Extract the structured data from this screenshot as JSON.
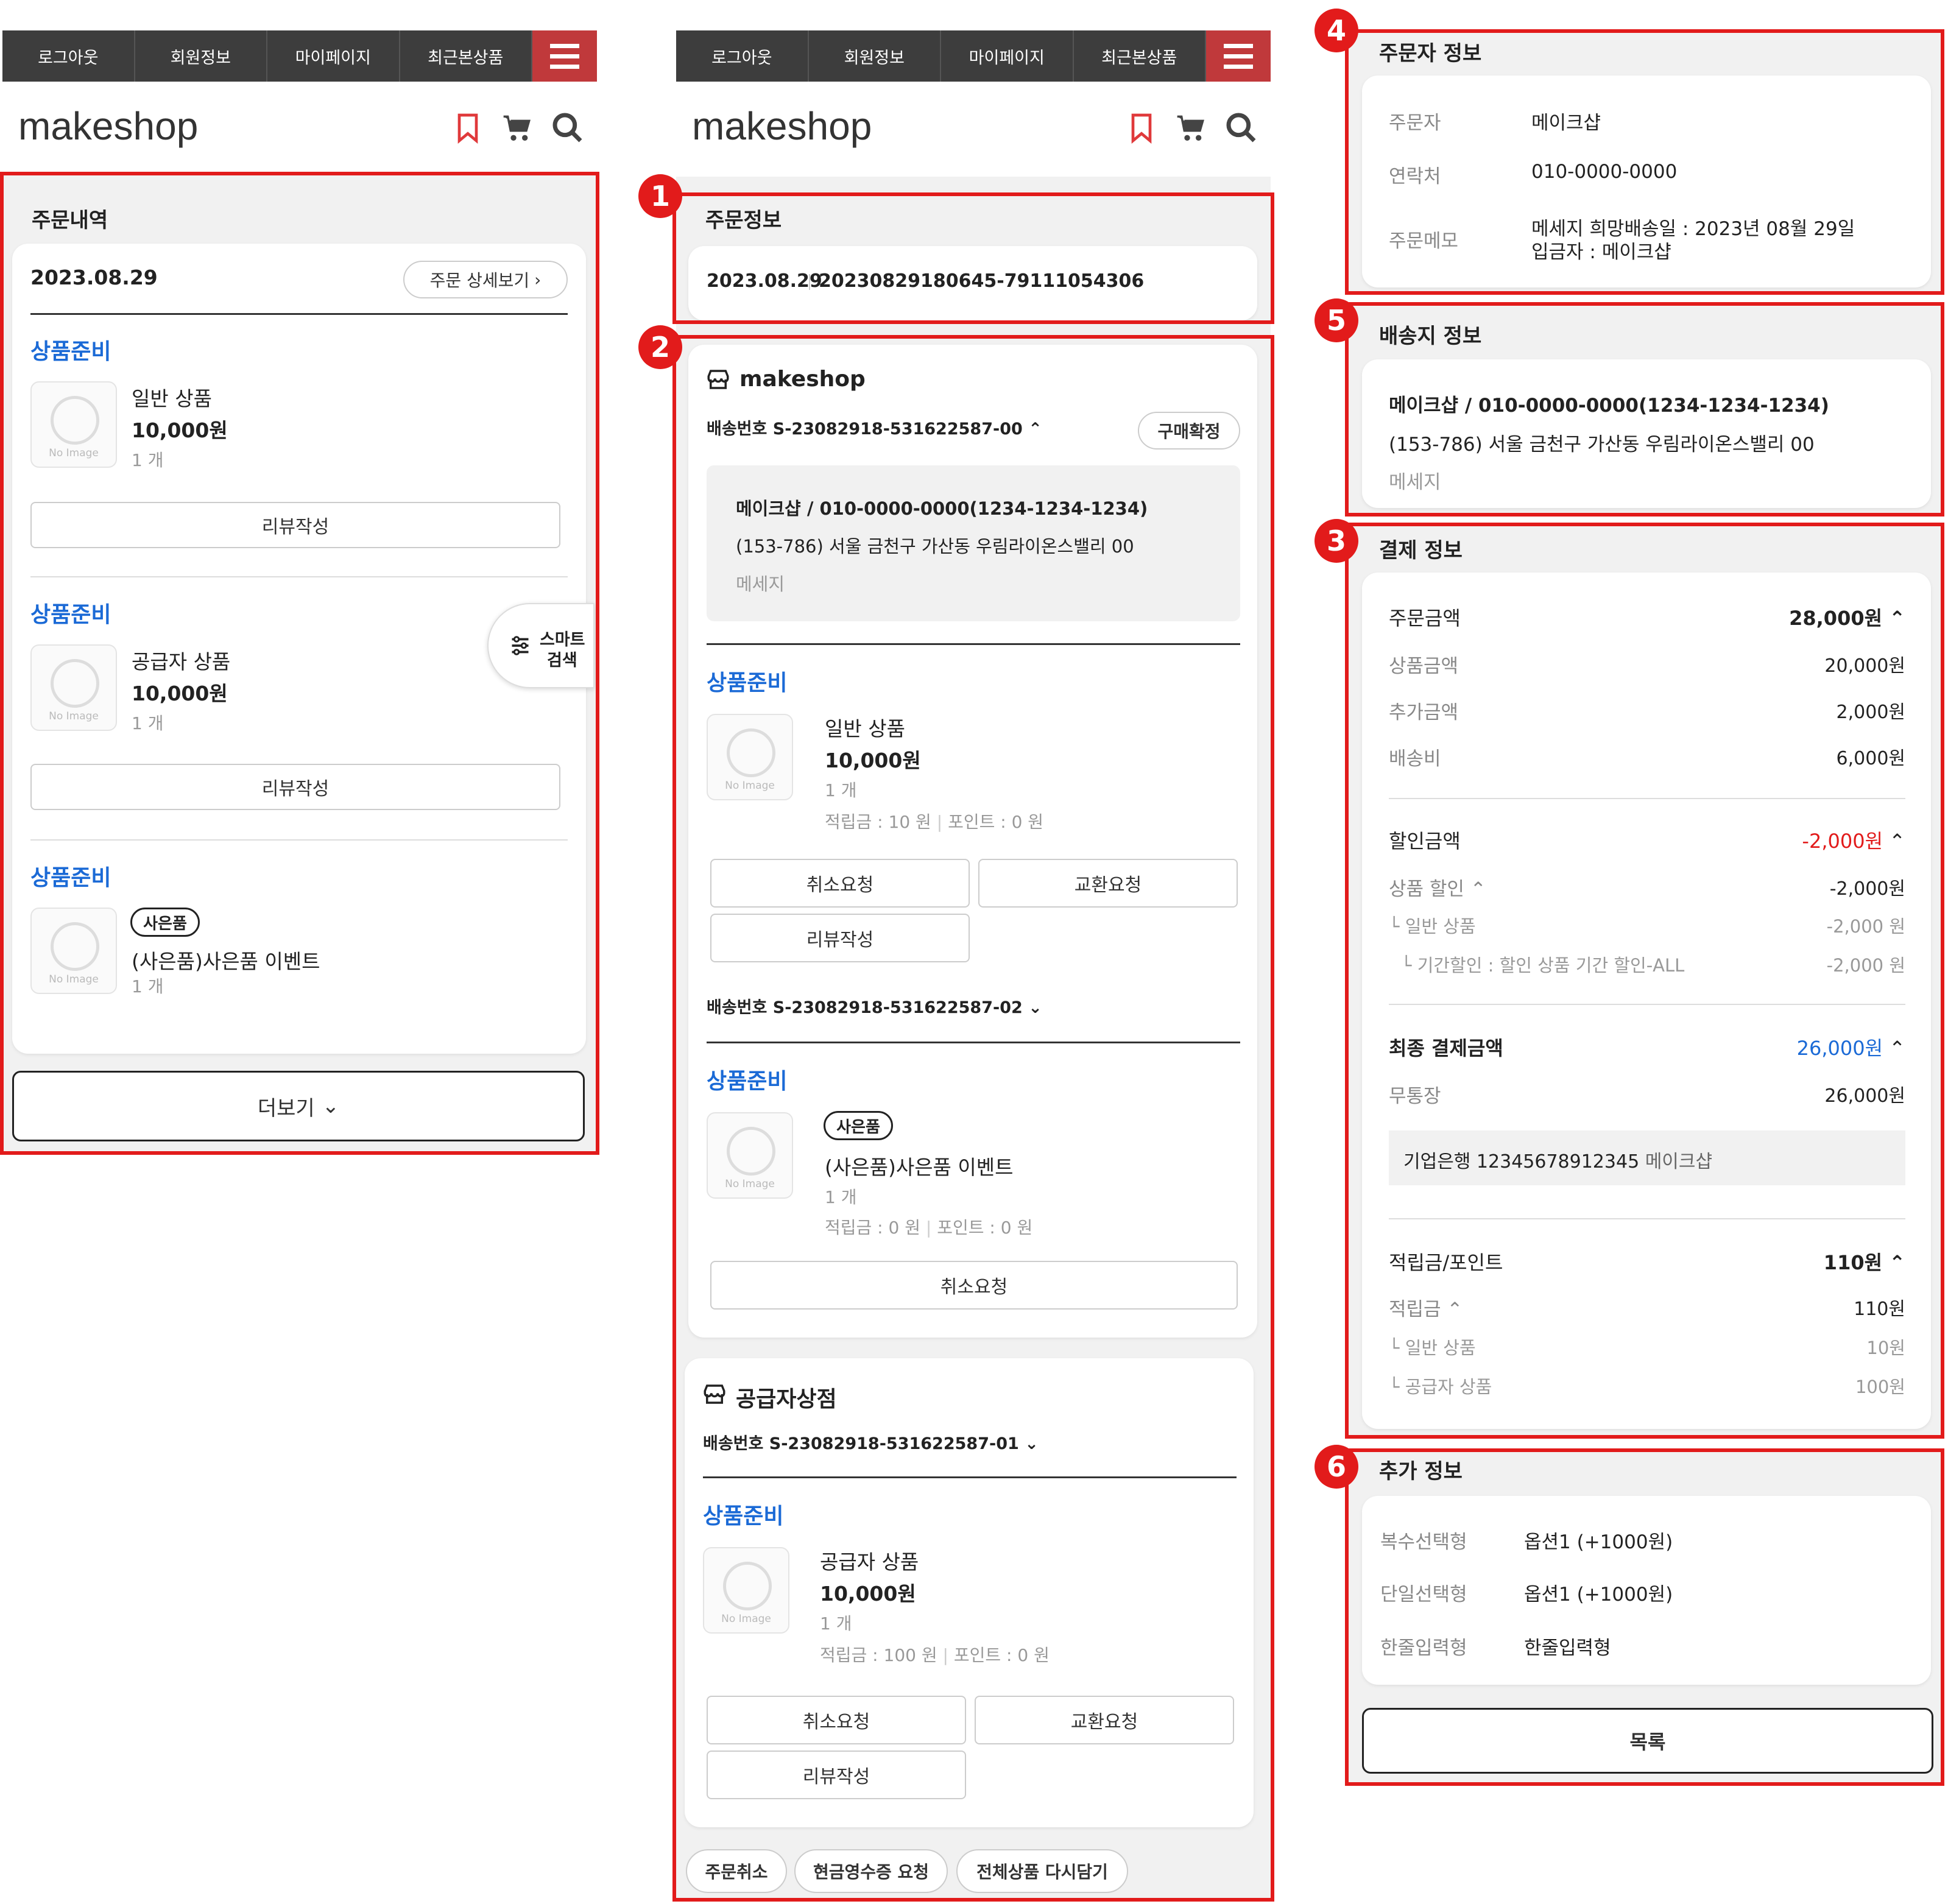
{
  "nav": {
    "items": [
      "로그아웃",
      "회원정보",
      "마이페이지",
      "최근본상품"
    ]
  },
  "header": {
    "logo": "makeshop"
  },
  "p1": {
    "section_title": "주문내역",
    "order_date": "2023.08.29",
    "detail_button": "주문 상세보기",
    "items": [
      {
        "status": "상품준비",
        "name": "일반 상품",
        "price": "10,000원",
        "qty": "1 개",
        "review": "리뷰작성"
      },
      {
        "status": "상품준비",
        "name": "공급자 상품",
        "price": "10,000원",
        "qty": "1 개",
        "review": "리뷰작성"
      },
      {
        "status": "상품준비",
        "tag": "사은품",
        "name": "(사은품)사은품 이벤트",
        "qty": "1 개"
      }
    ],
    "smart_search_line1": "스마트",
    "smart_search_line2": "검색",
    "more_button": "더보기",
    "noimage": "No Image"
  },
  "p2": {
    "badge1": "1",
    "badge2": "2",
    "order_info_title": "주문정보",
    "order_date": "2023.08.29",
    "order_no": "20230829180645-79111054306",
    "shop1": "makeshop",
    "ship1": "배송번호 S-23082918-531622587-00",
    "confirm": "구매확정",
    "addr_name": "메이크샵 / 010-0000-0000(1234-1234-1234)",
    "addr": "(153-786) 서울 금천구 가산동 우림라이온스밸리 00",
    "addr_msg": "메세지",
    "status": "상품준비",
    "item1": {
      "name": "일반 상품",
      "price": "10,000원",
      "qty": "1 개",
      "points": "적립금 : 10 원",
      "pts2": "포인트 : 0 원"
    },
    "cancel": "취소요청",
    "exchange": "교환요청",
    "review": "리뷰작성",
    "ship2": "배송번호 S-23082918-531622587-02",
    "item2": {
      "tag": "사은품",
      "name": "(사은품)사은품 이벤트",
      "qty": "1 개",
      "points": "적립금 : 0 원",
      "pts2": "포인트 : 0 원"
    },
    "shop2": "공급자상점",
    "ship3": "배송번호 S-23082918-531622587-01",
    "item3": {
      "name": "공급자 상품",
      "price": "10,000원",
      "qty": "1 개",
      "points": "적립금 : 100 원",
      "pts2": "포인트 : 0 원"
    },
    "bottom": [
      "주문취소",
      "현금영수증 요청",
      "전체상품 다시담기"
    ]
  },
  "p3": {
    "badge4": "4",
    "badge5": "5",
    "badge3": "3",
    "badge6": "6",
    "orderer_title": "주문자 정보",
    "orderer": [
      {
        "label": "주문자",
        "value": "메이크샵"
      },
      {
        "label": "연락처",
        "value": "010-0000-0000"
      },
      {
        "label": "주문메모",
        "value": "메세지 희망배송일 : 2023년 08월 29일",
        "value2": "입금자 : 메이크샵"
      }
    ],
    "ship_title": "배송지 정보",
    "ship_name": "메이크샵 / 010-0000-0000(1234-1234-1234)",
    "ship_addr": "(153-786) 서울 금천구 가산동 우림라이온스밸리 00",
    "ship_msg": "메세지",
    "pay_title": "결제 정보",
    "order_amount": {
      "label": "주문금액",
      "value": "28,000원"
    },
    "product_amount": {
      "label": "상품금액",
      "value": "20,000원"
    },
    "extra_amount": {
      "label": "추가금액",
      "value": "2,000원"
    },
    "shipping_fee": {
      "label": "배송비",
      "value": "6,000원"
    },
    "discount": {
      "label": "할인금액",
      "value": "-2,000원"
    },
    "product_discount": {
      "label": "상품 할인",
      "value": "-2,000원"
    },
    "disc_item": {
      "label": "일반 상품",
      "value": "-2,000 원"
    },
    "disc_period": {
      "label": "기간할인 : 할인 상품 기간 할인-ALL",
      "value": "-2,000 원"
    },
    "final": {
      "label": "최종 결제금액",
      "value": "26,000원"
    },
    "bank": {
      "label": "무통장",
      "value": "26,000원"
    },
    "bank_info": "기업은행 12345678912345",
    "bank_holder": "메이크샵",
    "points": {
      "label": "적립금/포인트",
      "value": "110원"
    },
    "points_sub": {
      "label": "적립금",
      "value": "110원"
    },
    "pts_item1": {
      "label": "일반 상품",
      "value": "10원"
    },
    "pts_item2": {
      "label": "공급자 상품",
      "value": "100원"
    },
    "extra_title": "추가 정보",
    "extra": [
      {
        "label": "복수선택형",
        "value": "옵션1 (+1000원)"
      },
      {
        "label": "단일선택형",
        "value": "옵션1 (+1000원)"
      },
      {
        "label": "한줄입력형",
        "value": "한줄입력형"
      }
    ],
    "list_button": "목록"
  },
  "colors": {
    "accent_red": "#e21b1b",
    "nav_bg": "#3d3d3d",
    "menu_bg": "#c0393b",
    "status_blue": "#1b6ad6",
    "discount_red": "#e21b1b"
  }
}
